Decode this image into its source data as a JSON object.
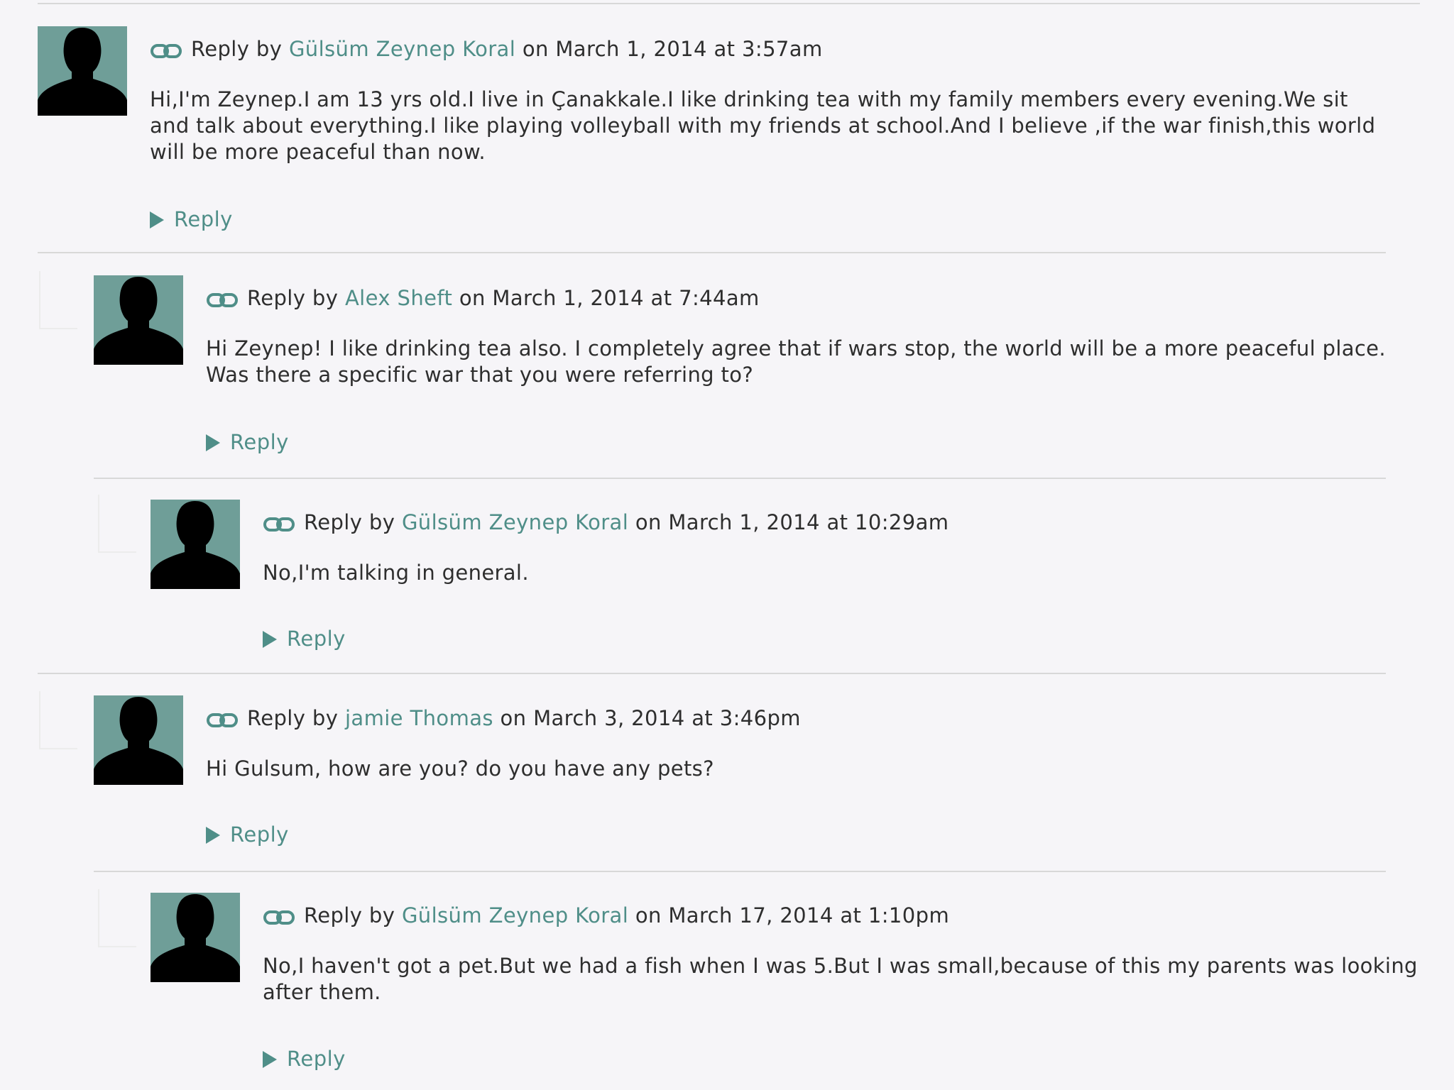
{
  "colors": {
    "accent": "#4f8e88",
    "avatar_bg": "#6f9e98",
    "avatar_silhouette": "#000000",
    "background": "#f6f5f8"
  },
  "comments": [
    {
      "prefix": "Reply by",
      "author": "Gülsüm Zeynep Koral",
      "date_text": "on March 1, 2014 at 3:57am",
      "body": "Hi,I'm Zeynep.I am 13 yrs old.I live in Çanakkale.I like drinking tea with my family members every evening.We sit and talk about everything.I like playing volleyball with my friends at school.And I believe ,if the war finish,this world will be more peaceful than now.",
      "reply_label": "Reply"
    },
    {
      "prefix": "Reply by",
      "author": "Alex Sheft",
      "date_text": "on March 1, 2014 at 7:44am",
      "body": "Hi Zeynep! I like drinking tea also. I completely agree that if wars stop, the world will be a more peaceful place. Was there a specific war that you were referring to?",
      "reply_label": "Reply"
    },
    {
      "prefix": "Reply by",
      "author": "Gülsüm Zeynep Koral",
      "date_text": "on March 1, 2014 at 10:29am",
      "body": "No,I'm talking in general.",
      "reply_label": "Reply"
    },
    {
      "prefix": "Reply by",
      "author": "jamie Thomas",
      "date_text": "on March 3, 2014 at 3:46pm",
      "body": "Hi Gulsum, how are you? do you have any pets?",
      "reply_label": "Reply"
    },
    {
      "prefix": "Reply by",
      "author": "Gülsüm Zeynep Koral",
      "date_text": "on March 17, 2014 at 1:10pm",
      "body": "No,I haven't got a pet.But we had a fish when I was 5.But I was small,because of this my parents was looking after them.",
      "reply_label": "Reply"
    }
  ]
}
